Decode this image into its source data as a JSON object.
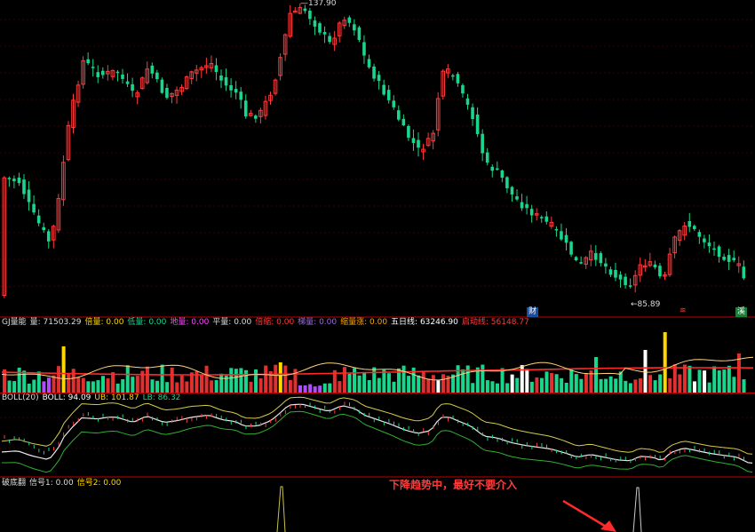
{
  "colors": {
    "background": "#000000",
    "up": "#ff3b3b",
    "down": "#19d68c",
    "grid": "#3a0000",
    "divider": "#c00000",
    "boll_mid": "#e8e8e8",
    "boll_upper": "#d4cc4a",
    "boll_lower": "#2fb02f",
    "ma_line": "#ff2a2a"
  },
  "price_panel": {
    "high_label": "137.90",
    "low_label": "85.89",
    "marker_finance": "财",
    "marker_flag": "≋",
    "marker_special": "溪"
  },
  "volume_panel": {
    "items": [
      {
        "text": "GJ量能",
        "color": "#dddddd"
      },
      {
        "text": "量: 71503.29",
        "color": "#dddddd"
      },
      {
        "text": "倍量: 0.00",
        "color": "#ffd700"
      },
      {
        "text": "低量: 0.00",
        "color": "#19d68c"
      },
      {
        "text": "地量: 0.00",
        "color": "#ff44ff"
      },
      {
        "text": "平量: 0.00",
        "color": "#dddddd"
      },
      {
        "text": "倍缩: 0.00",
        "color": "#ff3b3b"
      },
      {
        "text": "梯量: 0.00",
        "color": "#9a6bd6"
      },
      {
        "text": "缩量涨: 0.00",
        "color": "#ffa500"
      },
      {
        "text": "五日线: 63246.90",
        "color": "#ffffff"
      },
      {
        "text": "启动线: 56148.77",
        "color": "#ff3b3b"
      }
    ]
  },
  "boll_panel": {
    "items": [
      {
        "text": "BOLL(20)",
        "color": "#dddddd"
      },
      {
        "text": "BOLL: 94.09",
        "color": "#ffffff"
      },
      {
        "text": "UB: 101.87",
        "color": "#ffd700"
      },
      {
        "text": "LB: 86.32",
        "color": "#19d68c"
      }
    ]
  },
  "signal_panel": {
    "items": [
      {
        "text": "破底翻",
        "color": "#dddddd"
      },
      {
        "text": "信号1: 0.00",
        "color": "#dddddd"
      },
      {
        "text": "信号2: 0.00",
        "color": "#ffd700"
      }
    ],
    "annotation": "下降趋势中，最好不要介入"
  }
}
